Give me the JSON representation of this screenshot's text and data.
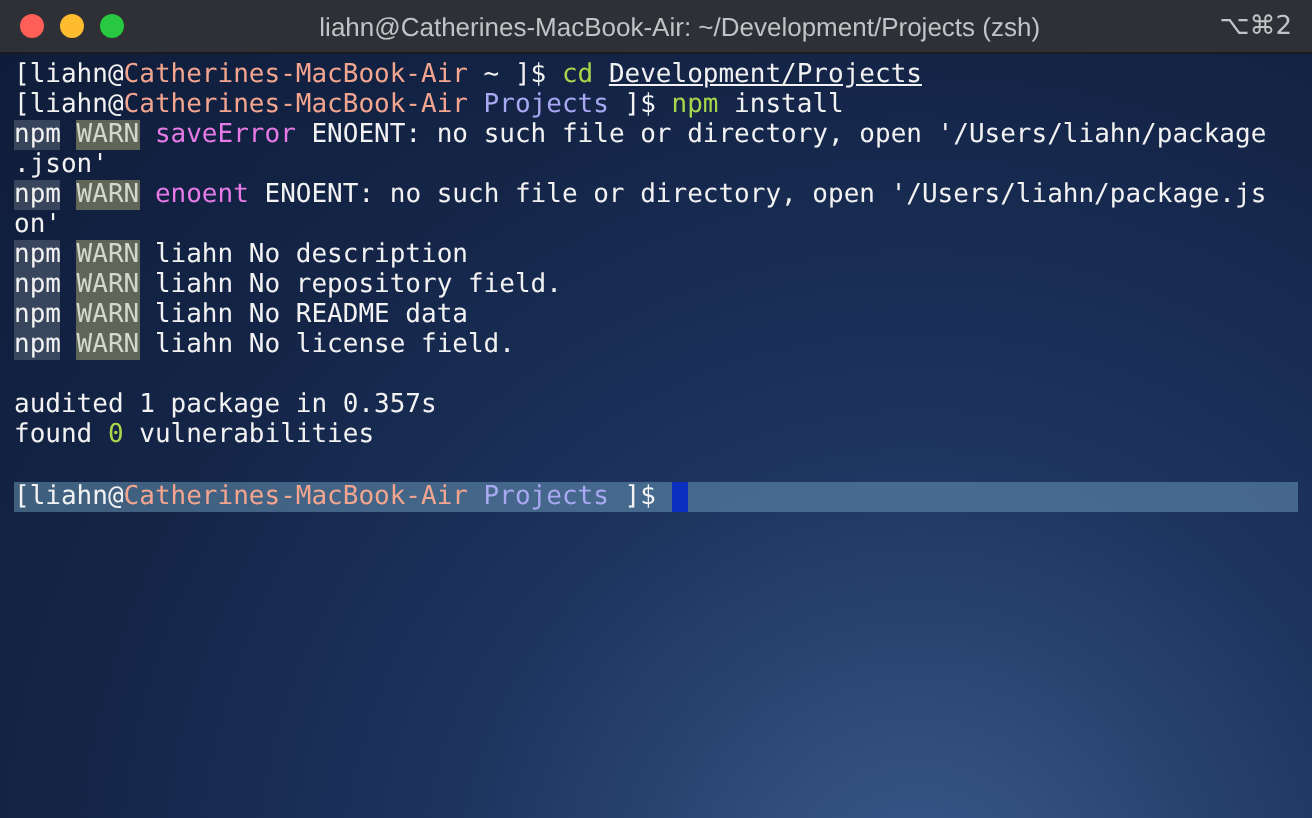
{
  "window": {
    "title": "liahn@Catherines-MacBook-Air: ~/Development/Projects (zsh)",
    "shortcut": "⌥⌘2"
  },
  "lines": [
    {
      "current": false,
      "segments": [
        {
          "kind": "text",
          "text": "[liahn@"
        },
        {
          "kind": "host",
          "text": "Catherines-MacBook-Air"
        },
        {
          "kind": "text",
          "text": " ~ ]$ "
        },
        {
          "kind": "cmd",
          "text": "cd "
        },
        {
          "kind": "link",
          "text": "Development/Projects"
        }
      ]
    },
    {
      "current": false,
      "segments": [
        {
          "kind": "text",
          "text": "[liahn@"
        },
        {
          "kind": "host",
          "text": "Catherines-MacBook-Air"
        },
        {
          "kind": "dir",
          "text": " Projects"
        },
        {
          "kind": "text",
          "text": " ]$ "
        },
        {
          "kind": "cmd",
          "text": "npm"
        },
        {
          "kind": "text",
          "text": " install"
        }
      ]
    },
    {
      "current": false,
      "segments": [
        {
          "kind": "npm",
          "text": "npm"
        },
        {
          "kind": "warn",
          "text": " WARN"
        },
        {
          "kind": "scope",
          "text": " saveError"
        },
        {
          "kind": "text",
          "text": " ENOENT: no such file or directory, open '/Users/liahn/package"
        }
      ]
    },
    {
      "current": false,
      "segments": [
        {
          "kind": "text",
          "text": ".json'"
        }
      ]
    },
    {
      "current": false,
      "segments": [
        {
          "kind": "npm",
          "text": "npm"
        },
        {
          "kind": "warn",
          "text": " WARN"
        },
        {
          "kind": "scope",
          "text": " enoent"
        },
        {
          "kind": "text",
          "text": " ENOENT: no such file or directory, open '/Users/liahn/package.js"
        }
      ]
    },
    {
      "current": false,
      "segments": [
        {
          "kind": "text",
          "text": "on'"
        }
      ]
    },
    {
      "current": false,
      "segments": [
        {
          "kind": "npm",
          "text": "npm"
        },
        {
          "kind": "warn",
          "text": " WARN"
        },
        {
          "kind": "text",
          "text": " liahn No description"
        }
      ]
    },
    {
      "current": false,
      "segments": [
        {
          "kind": "npm",
          "text": "npm"
        },
        {
          "kind": "warn",
          "text": " WARN"
        },
        {
          "kind": "text",
          "text": " liahn No repository field."
        }
      ]
    },
    {
      "current": false,
      "segments": [
        {
          "kind": "npm",
          "text": "npm"
        },
        {
          "kind": "warn",
          "text": " WARN"
        },
        {
          "kind": "text",
          "text": " liahn No README data"
        }
      ]
    },
    {
      "current": false,
      "segments": [
        {
          "kind": "npm",
          "text": "npm"
        },
        {
          "kind": "warn",
          "text": " WARN"
        },
        {
          "kind": "text",
          "text": " liahn No license field."
        }
      ]
    },
    {
      "current": false
    },
    {
      "current": false,
      "segments": [
        {
          "kind": "text",
          "text": "audited 1 package in 0.357s"
        }
      ]
    },
    {
      "current": false,
      "segments": [
        {
          "kind": "text",
          "text": "found "
        },
        {
          "kind": "count",
          "text": "0"
        },
        {
          "kind": "text",
          "text": " vulnerabilities"
        }
      ]
    },
    {
      "current": false
    },
    {
      "current": true,
      "segments": [
        {
          "kind": "text",
          "text": "[liahn@"
        },
        {
          "kind": "host",
          "text": "Catherines-MacBook-Air"
        },
        {
          "kind": "dir",
          "text": " Projects"
        },
        {
          "kind": "text",
          "text": " ]$ "
        }
      ]
    }
  ]
}
